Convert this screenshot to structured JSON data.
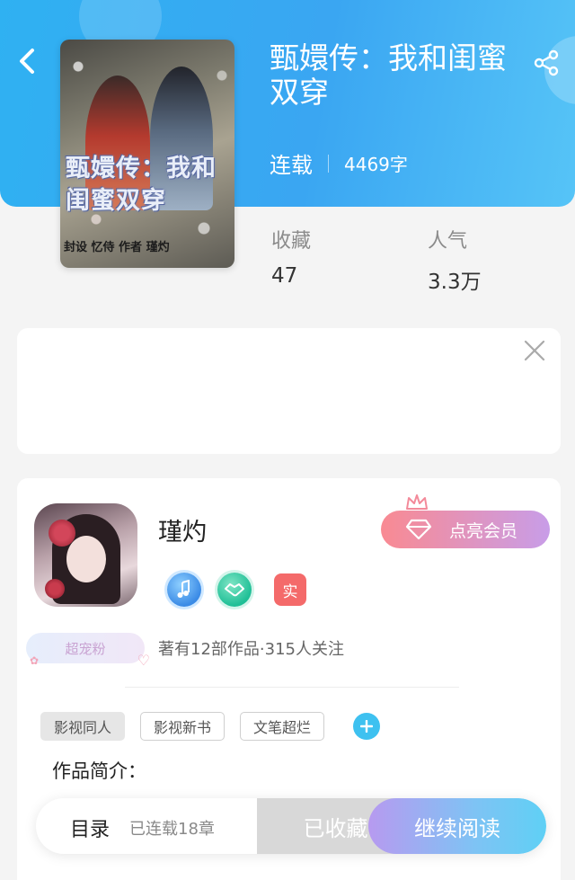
{
  "book": {
    "title": "甄嬛传：我和闺蜜双穿",
    "status": "连载",
    "word_count": "4469字",
    "cover_title": "甄嬛传：我和闺蜜双穿",
    "cover_credit": "封设 忆侍    作者 瑾灼"
  },
  "stats": {
    "favorites_label": "收藏",
    "favorites_value": "47",
    "popularity_label": "人气",
    "popularity_value": "3.3万"
  },
  "author": {
    "name": "瑾灼",
    "real_badge": "实",
    "vip_label": "点亮会员",
    "fan_badge": "超宠粉",
    "meta": "著有12部作品·315人关注"
  },
  "tags": [
    "影视同人",
    "影视新书",
    "文笔超烂"
  ],
  "intro_label": "作品简介：",
  "bottom_bar": {
    "toc_label": "目录",
    "toc_sub": "已连载18章",
    "collected_label": "已收藏",
    "read_label": "继续阅读"
  },
  "icons": {
    "back": "chevron-left-icon",
    "share": "share-icon",
    "close": "close-icon",
    "crown": "crown-icon",
    "diamond": "diamond-icon",
    "music_badge": "music-note-icon",
    "handshake_badge": "handshake-icon",
    "add": "plus-icon"
  },
  "colors": {
    "header_blue": "#2fb1f2",
    "accent_cyan": "#3ec1f0",
    "vip_pink": "#f98a92",
    "vip_purple": "#c89de8",
    "real_red": "#f46a6a"
  }
}
